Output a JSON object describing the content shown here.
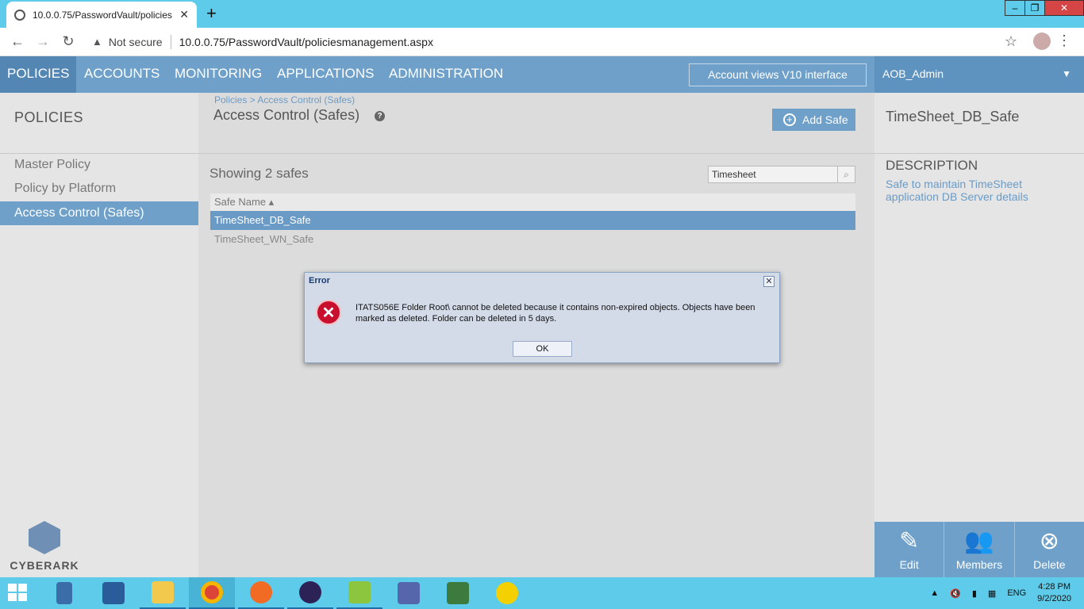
{
  "browser": {
    "tab_title": "10.0.0.75/PasswordVault/policies",
    "not_secure": "Not secure",
    "url": "10.0.0.75/PasswordVault/policiesmanagement.aspx"
  },
  "appnav": {
    "items": [
      "POLICIES",
      "ACCOUNTS",
      "MONITORING",
      "APPLICATIONS",
      "ADMINISTRATION"
    ],
    "v10_button": "Account views V10 interface",
    "user": "AOB_Admin"
  },
  "sidebar": {
    "heading": "POLICIES",
    "items": [
      "Master Policy",
      "Policy by Platform",
      "Access Control (Safes)"
    ],
    "logo_text": "CYBERARK"
  },
  "main": {
    "breadcrumb": "Policies > Access Control (Safes)",
    "title": "Access Control (Safes)",
    "help": "?",
    "add_safe": "Add Safe",
    "showing": "Showing 2 safes",
    "search_value": "Timesheet",
    "column_header": "Safe Name ▴",
    "rows": [
      "TimeSheet_DB_Safe",
      "TimeSheet_WN_Safe"
    ]
  },
  "details": {
    "safe_name": "TimeSheet_DB_Safe",
    "description_label": "DESCRIPTION",
    "description": "Safe to maintain TimeSheet application DB Server details",
    "actions": [
      "Edit",
      "Members",
      "Delete"
    ]
  },
  "dialog": {
    "title": "Error",
    "message": "ITATS056E Folder Root\\ cannot be deleted because it contains non-expired objects. Objects have been marked as deleted. Folder can be deleted in 5 days.",
    "ok": "OK"
  },
  "taskbar": {
    "lang": "ENG",
    "time": "4:28 PM",
    "date": "9/2/2020"
  }
}
